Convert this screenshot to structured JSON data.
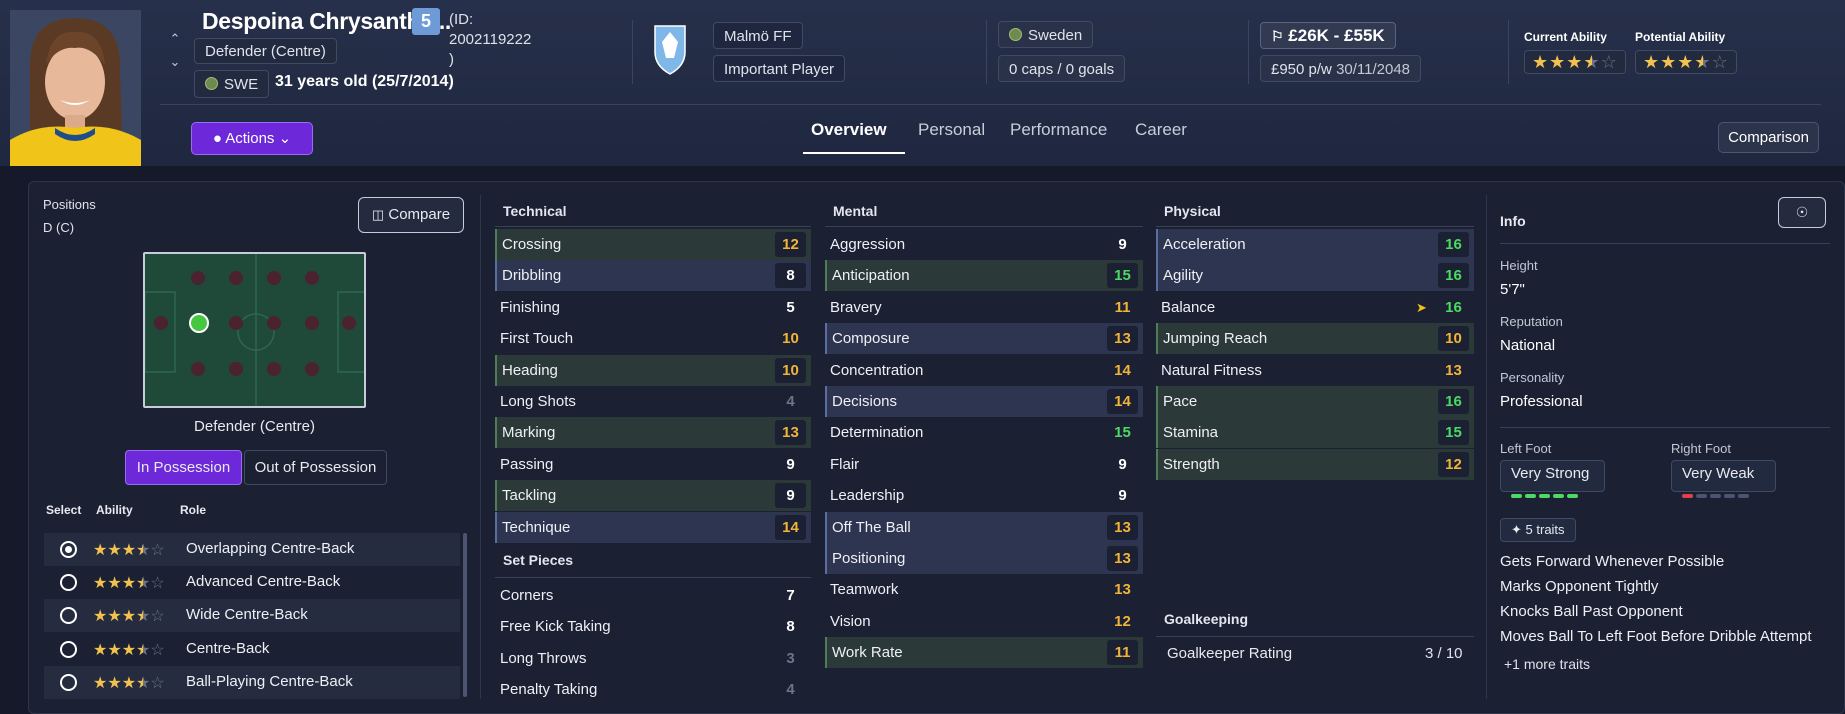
{
  "player": {
    "name": "Despoina Chrysantha...",
    "number": "5",
    "id_line1": "(ID:",
    "id_line2": "2002119222",
    "id_line3": ")",
    "position": "Defender (Centre)",
    "nation_code": "SWE",
    "age": "31 years old (25/7/2014)"
  },
  "club": {
    "name": "Malmö FF",
    "status": "Important Player"
  },
  "nation": {
    "name": "Sweden",
    "caps": "0 caps / 0 goals"
  },
  "contract": {
    "value": "£26K - £55K",
    "wage": "£950 p/w",
    "expiry": "30/11/2048"
  },
  "ability": {
    "current_label": "Current Ability",
    "potential_label": "Potential Ability",
    "current_stars": 3.5,
    "potential_stars": 3.5
  },
  "actions_label": "Actions",
  "tabs": [
    "Overview",
    "Personal",
    "Performance",
    "Career"
  ],
  "comparison_label": "Comparison",
  "positions": {
    "title": "Positions",
    "code": "D (C)",
    "compare_label": "Compare",
    "pitch_label": "Defender (Centre)",
    "in_possession": "In Possession",
    "out_possession": "Out of Possession",
    "col_select": "Select",
    "col_ability": "Ability",
    "col_role": "Role",
    "roles": [
      {
        "name": "Overlapping Centre-Back",
        "stars": 3.5,
        "selected": true
      },
      {
        "name": "Advanced Centre-Back",
        "stars": 3.5,
        "selected": false
      },
      {
        "name": "Wide Centre-Back",
        "stars": 3.5,
        "selected": false
      },
      {
        "name": "Centre-Back",
        "stars": 3.5,
        "selected": false
      },
      {
        "name": "Ball-Playing Centre-Back",
        "stars": 3.5,
        "selected": false
      }
    ]
  },
  "technical": {
    "title": "Technical",
    "attrs": [
      {
        "name": "Crossing",
        "value": "12",
        "hl": "green"
      },
      {
        "name": "Dribbling",
        "value": "8",
        "hl": "blue"
      },
      {
        "name": "Finishing",
        "value": "5",
        "hl": ""
      },
      {
        "name": "First Touch",
        "value": "10",
        "hl": ""
      },
      {
        "name": "Heading",
        "value": "10",
        "hl": "green"
      },
      {
        "name": "Long Shots",
        "value": "4",
        "hl": ""
      },
      {
        "name": "Marking",
        "value": "13",
        "hl": "green"
      },
      {
        "name": "Passing",
        "value": "9",
        "hl": ""
      },
      {
        "name": "Tackling",
        "value": "9",
        "hl": "green"
      },
      {
        "name": "Technique",
        "value": "14",
        "hl": "blue"
      }
    ]
  },
  "set_pieces": {
    "title": "Set Pieces",
    "attrs": [
      {
        "name": "Corners",
        "value": "7",
        "hl": ""
      },
      {
        "name": "Free Kick Taking",
        "value": "8",
        "hl": ""
      },
      {
        "name": "Long Throws",
        "value": "3",
        "hl": ""
      },
      {
        "name": "Penalty Taking",
        "value": "4",
        "hl": ""
      }
    ]
  },
  "mental": {
    "title": "Mental",
    "attrs": [
      {
        "name": "Aggression",
        "value": "9",
        "hl": ""
      },
      {
        "name": "Anticipation",
        "value": "15",
        "hl": "green"
      },
      {
        "name": "Bravery",
        "value": "11",
        "hl": ""
      },
      {
        "name": "Composure",
        "value": "13",
        "hl": "blue"
      },
      {
        "name": "Concentration",
        "value": "14",
        "hl": ""
      },
      {
        "name": "Decisions",
        "value": "14",
        "hl": "blue"
      },
      {
        "name": "Determination",
        "value": "15",
        "hl": ""
      },
      {
        "name": "Flair",
        "value": "9",
        "hl": ""
      },
      {
        "name": "Leadership",
        "value": "9",
        "hl": ""
      },
      {
        "name": "Off The Ball",
        "value": "13",
        "hl": "blue"
      },
      {
        "name": "Positioning",
        "value": "13",
        "hl": "blue"
      },
      {
        "name": "Teamwork",
        "value": "13",
        "hl": ""
      },
      {
        "name": "Vision",
        "value": "12",
        "hl": ""
      },
      {
        "name": "Work Rate",
        "value": "11",
        "hl": "green"
      }
    ]
  },
  "physical": {
    "title": "Physical",
    "attrs": [
      {
        "name": "Acceleration",
        "value": "16",
        "hl": "blue"
      },
      {
        "name": "Agility",
        "value": "16",
        "hl": "blue"
      },
      {
        "name": "Balance",
        "value": "16",
        "hl": ""
      },
      {
        "name": "Jumping Reach",
        "value": "10",
        "hl": "green"
      },
      {
        "name": "Natural Fitness",
        "value": "13",
        "hl": ""
      },
      {
        "name": "Pace",
        "value": "16",
        "hl": "green"
      },
      {
        "name": "Stamina",
        "value": "15",
        "hl": "green"
      },
      {
        "name": "Strength",
        "value": "12",
        "hl": "green"
      }
    ]
  },
  "goalkeeping": {
    "title": "Goalkeeping",
    "label": "Goalkeeper Rating",
    "value": "3 / 10"
  },
  "info": {
    "title": "Info",
    "height_label": "Height",
    "height": "5'7\"",
    "reputation_label": "Reputation",
    "reputation": "National",
    "personality_label": "Personality",
    "personality": "Professional",
    "left_foot_label": "Left Foot",
    "left_foot": "Very Strong",
    "left_foot_level": 5,
    "right_foot_label": "Right Foot",
    "right_foot": "Very Weak",
    "right_foot_level": 1,
    "traits_count": "5 traits",
    "traits": [
      "Gets Forward Whenever Possible",
      "Marks Opponent Tightly",
      "Knocks Ball Past Opponent",
      "Moves Ball To Left Foot Before Dribble Attempt"
    ],
    "more_traits": "+1 more traits"
  },
  "colors": {
    "accent": "#6d28d9",
    "yellow": "#f0b43a",
    "green": "#4cd964",
    "star": "#f2c14e"
  }
}
